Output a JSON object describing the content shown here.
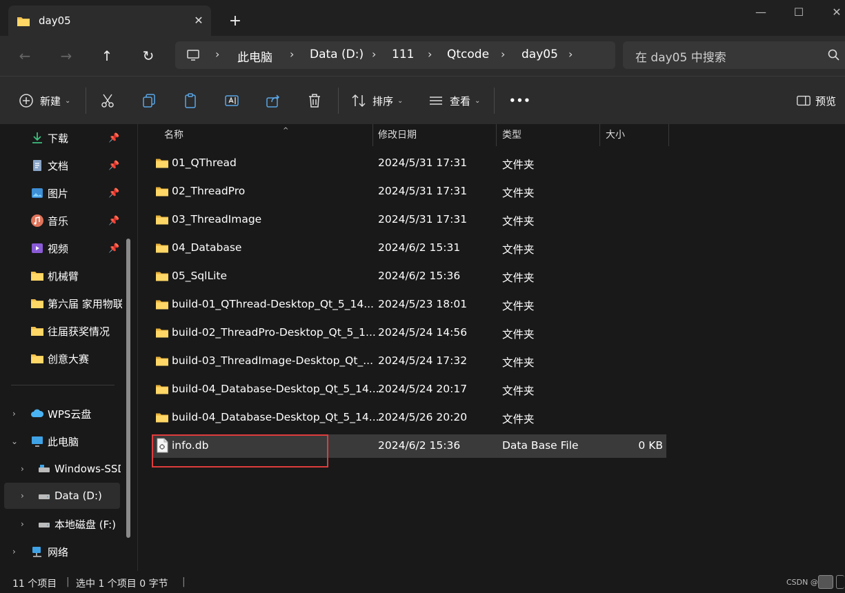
{
  "tab": {
    "title": "day05",
    "close": "✕",
    "new": "+"
  },
  "window": {
    "minimize": "—",
    "maximize": "☐",
    "close": "✕"
  },
  "nav": {
    "back": "←",
    "forward": "→",
    "up": "↑",
    "refresh": "↻"
  },
  "address": {
    "segments": [
      "此电脑",
      "Data (D:)",
      "111",
      "Qtcode",
      "day05"
    ],
    "chevron": "›"
  },
  "search": {
    "placeholder": "在 day05 中搜索"
  },
  "toolbar": {
    "new_label": "新建",
    "sort_label": "排序",
    "view_label": "查看",
    "more_label": "•••",
    "preview_label": "预览",
    "caret": "⌄"
  },
  "sidebar": {
    "quick": [
      {
        "label": "下载",
        "icon": "download-icon",
        "pin": "📌"
      },
      {
        "label": "文档",
        "icon": "document-icon",
        "pin": "📌"
      },
      {
        "label": "图片",
        "icon": "pictures-icon",
        "pin": "📌"
      },
      {
        "label": "音乐",
        "icon": "music-icon",
        "pin": "📌"
      },
      {
        "label": "视频",
        "icon": "video-icon",
        "pin": "📌"
      },
      {
        "label": "机械臂",
        "icon": "folder-icon"
      },
      {
        "label": "第六届 家用物联",
        "icon": "folder-icon"
      },
      {
        "label": "往届获奖情况",
        "icon": "folder-icon"
      },
      {
        "label": "创意大赛",
        "icon": "folder-icon"
      }
    ],
    "tree": [
      {
        "label": "WPS云盘",
        "icon": "cloud-icon",
        "expander": "›"
      },
      {
        "label": "此电脑",
        "icon": "computer-icon",
        "expander": "⌄"
      },
      {
        "label": "Windows-SSD",
        "icon": "drive-icon",
        "expander": "›"
      },
      {
        "label": "Data (D:)",
        "icon": "drive-icon",
        "expander": "›"
      },
      {
        "label": "本地磁盘 (F:)",
        "icon": "drive-icon",
        "expander": "›"
      },
      {
        "label": "网络",
        "icon": "network-icon",
        "expander": "›"
      }
    ]
  },
  "columns": {
    "name": "名称",
    "modified": "修改日期",
    "type": "类型",
    "size": "大小",
    "sort_arrow": "^"
  },
  "files": [
    {
      "name": "01_QThread",
      "modified": "2024/5/31 17:31",
      "type": "文件夹",
      "size": "",
      "kind": "folder"
    },
    {
      "name": "02_ThreadPro",
      "modified": "2024/5/31 17:31",
      "type": "文件夹",
      "size": "",
      "kind": "folder"
    },
    {
      "name": "03_ThreadImage",
      "modified": "2024/5/31 17:31",
      "type": "文件夹",
      "size": "",
      "kind": "folder"
    },
    {
      "name": "04_Database",
      "modified": "2024/6/2 15:31",
      "type": "文件夹",
      "size": "",
      "kind": "folder"
    },
    {
      "name": "05_SqlLite",
      "modified": "2024/6/2 15:36",
      "type": "文件夹",
      "size": "",
      "kind": "folder"
    },
    {
      "name": "build-01_QThread-Desktop_Qt_5_14...",
      "modified": "2024/5/23 18:01",
      "type": "文件夹",
      "size": "",
      "kind": "folder"
    },
    {
      "name": "build-02_ThreadPro-Desktop_Qt_5_1...",
      "modified": "2024/5/24 14:56",
      "type": "文件夹",
      "size": "",
      "kind": "folder"
    },
    {
      "name": "build-03_ThreadImage-Desktop_Qt_...",
      "modified": "2024/5/24 17:32",
      "type": "文件夹",
      "size": "",
      "kind": "folder"
    },
    {
      "name": "build-04_Database-Desktop_Qt_5_14...",
      "modified": "2024/5/24 20:17",
      "type": "文件夹",
      "size": "",
      "kind": "folder"
    },
    {
      "name": "build-04_Database-Desktop_Qt_5_14...",
      "modified": "2024/5/26 20:20",
      "type": "文件夹",
      "size": "",
      "kind": "folder"
    },
    {
      "name": "info.db",
      "modified": "2024/6/2 15:36",
      "type": "Data Base File",
      "size": "0 KB",
      "kind": "file",
      "selected": true
    }
  ],
  "status": {
    "count": "11 个项目",
    "selected": "选中 1 个项目  0 字节",
    "sep": "|",
    "watermark": "CSDN @"
  },
  "colors": {
    "accent_folder": "#f2c14e",
    "highlight": "#e03c3c",
    "selection": "#3a3a3a"
  }
}
